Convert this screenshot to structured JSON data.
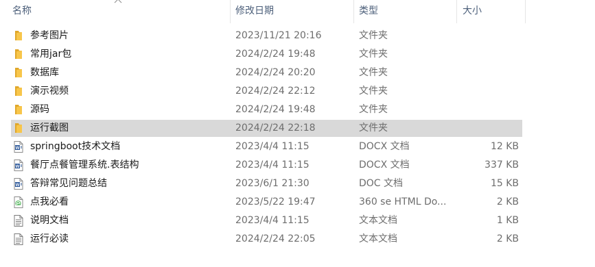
{
  "columns": {
    "name": "名称",
    "modified": "修改日期",
    "type": "类型",
    "size": "大小"
  },
  "colors": {
    "header_text": "#4c5f7a",
    "selected_row": "#d9d9d9",
    "folder": "#f8c64b",
    "word": "#2b579a"
  },
  "files": [
    {
      "name": "参考图片",
      "modified": "2023/11/21 20:16",
      "type": "文件夹",
      "size": "",
      "icon": "folder-icon"
    },
    {
      "name": "常用jar包",
      "modified": "2024/2/24 19:48",
      "type": "文件夹",
      "size": "",
      "icon": "folder-icon"
    },
    {
      "name": "数据库",
      "modified": "2024/2/24 20:20",
      "type": "文件夹",
      "size": "",
      "icon": "folder-icon"
    },
    {
      "name": "演示视频",
      "modified": "2024/2/24 22:12",
      "type": "文件夹",
      "size": "",
      "icon": "folder-icon"
    },
    {
      "name": "源码",
      "modified": "2024/2/24 19:48",
      "type": "文件夹",
      "size": "",
      "icon": "folder-icon"
    },
    {
      "name": "运行截图",
      "modified": "2024/2/24 22:18",
      "type": "文件夹",
      "size": "",
      "icon": "folder-icon",
      "selected": true
    },
    {
      "name": "springboot技术文档",
      "modified": "2023/4/4 11:15",
      "type": "DOCX 文档",
      "size": "12 KB",
      "icon": "word-doc-icon"
    },
    {
      "name": "餐厅点餐管理系统.表结构",
      "modified": "2023/4/4 11:15",
      "type": "DOCX 文档",
      "size": "337 KB",
      "icon": "word-doc-icon"
    },
    {
      "name": "答辩常见问题总结",
      "modified": "2023/6/1 21:30",
      "type": "DOC 文档",
      "size": "15 KB",
      "icon": "word-doc-icon"
    },
    {
      "name": "点我必看",
      "modified": "2023/5/22 19:47",
      "type": "360 se HTML Do...",
      "size": "2 KB",
      "icon": "html-file-icon"
    },
    {
      "name": "说明文档",
      "modified": "2023/4/4 11:15",
      "type": "文本文档",
      "size": "1 KB",
      "icon": "text-file-icon"
    },
    {
      "name": "运行必读",
      "modified": "2024/2/24 22:05",
      "type": "文本文档",
      "size": "2 KB",
      "icon": "text-file-icon"
    }
  ]
}
